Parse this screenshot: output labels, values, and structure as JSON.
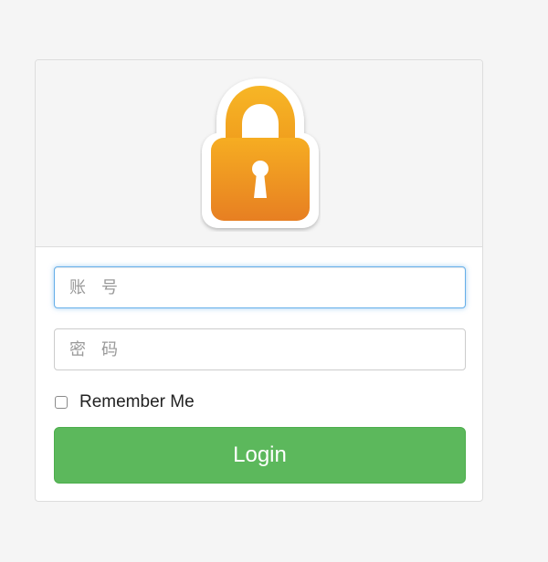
{
  "header": {
    "logo_icon": "lock-icon"
  },
  "form": {
    "username_placeholder": "账 号",
    "password_placeholder": "密 码",
    "remember_label": "Remember Me",
    "remember_checked": false,
    "login_label": "Login"
  },
  "colors": {
    "login_button": "#5cb85c",
    "lock_body": "#f2a31f",
    "focus_border": "#66afe9"
  }
}
